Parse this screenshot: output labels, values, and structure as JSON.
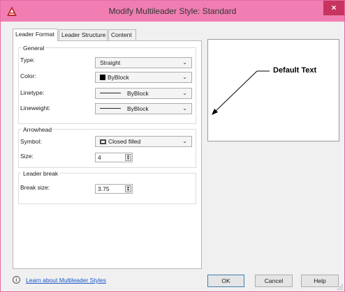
{
  "window": {
    "title": "Modify Multileader Style: Standard",
    "close_label": "×",
    "accent_color": "#f07eb2"
  },
  "tabs": [
    {
      "label": "Leader Format",
      "active": true
    },
    {
      "label": "Leader Structure",
      "active": false
    },
    {
      "label": "Content",
      "active": false
    }
  ],
  "general": {
    "title": "General",
    "type": {
      "label": "Type:",
      "value": "Straight"
    },
    "color": {
      "label": "Color:",
      "value": "ByBlock",
      "swatch": "#000000"
    },
    "linetype": {
      "label": "Linetype:",
      "value": "ByBlock"
    },
    "lineweight": {
      "label": "Lineweight:",
      "value": "ByBlock"
    }
  },
  "arrowhead": {
    "title": "Arrowhead",
    "symbol": {
      "label": "Symbol:",
      "value": "Closed filled",
      "icon": "closed-filled-arrow-icon"
    },
    "size": {
      "label": "Size:",
      "value": "4"
    }
  },
  "leader_break": {
    "title": "Leader break",
    "break_size": {
      "label": "Break size:",
      "value": "3.75"
    }
  },
  "preview": {
    "text": "Default Text"
  },
  "footer": {
    "help_link": "Learn about Multileader Styles",
    "info_icon": "info-icon",
    "ok_label": "OK",
    "cancel_label": "Cancel",
    "help_label": "Help"
  }
}
